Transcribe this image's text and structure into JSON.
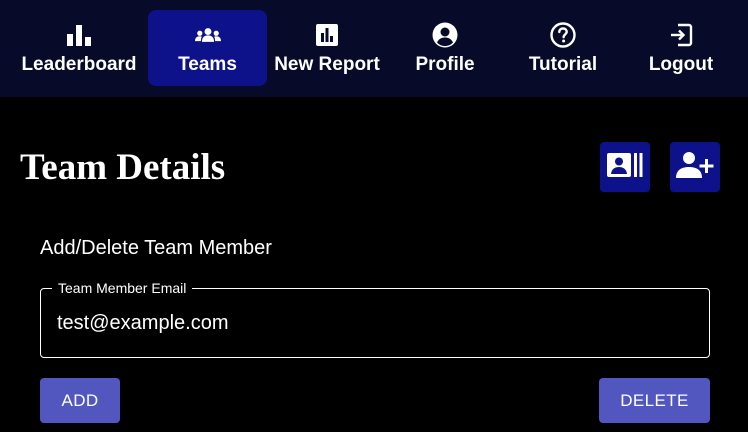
{
  "nav": {
    "items": [
      {
        "label": "Leaderboard",
        "icon": "leaderboard-icon",
        "active": false
      },
      {
        "label": "Teams",
        "icon": "groups-icon",
        "active": true
      },
      {
        "label": "New Report",
        "icon": "report-icon",
        "active": false
      },
      {
        "label": "Profile",
        "icon": "account-circle-icon",
        "active": false
      },
      {
        "label": "Tutorial",
        "icon": "help-icon",
        "active": false
      },
      {
        "label": "Logout",
        "icon": "logout-icon",
        "active": false
      }
    ]
  },
  "page": {
    "title": "Team Details",
    "actions": [
      {
        "icon": "contact-card-icon"
      },
      {
        "icon": "add-user-icon"
      }
    ]
  },
  "member_form": {
    "section_title": "Add/Delete Team Member",
    "email_label": "Team Member Email",
    "email_value": "test@example.com",
    "add_label": "ADD",
    "delete_label": "DELETE"
  },
  "colors": {
    "nav_background": "#070a28",
    "accent": "#0d128a",
    "button": "#5157bf",
    "background": "#000000",
    "text": "#ffffff"
  }
}
